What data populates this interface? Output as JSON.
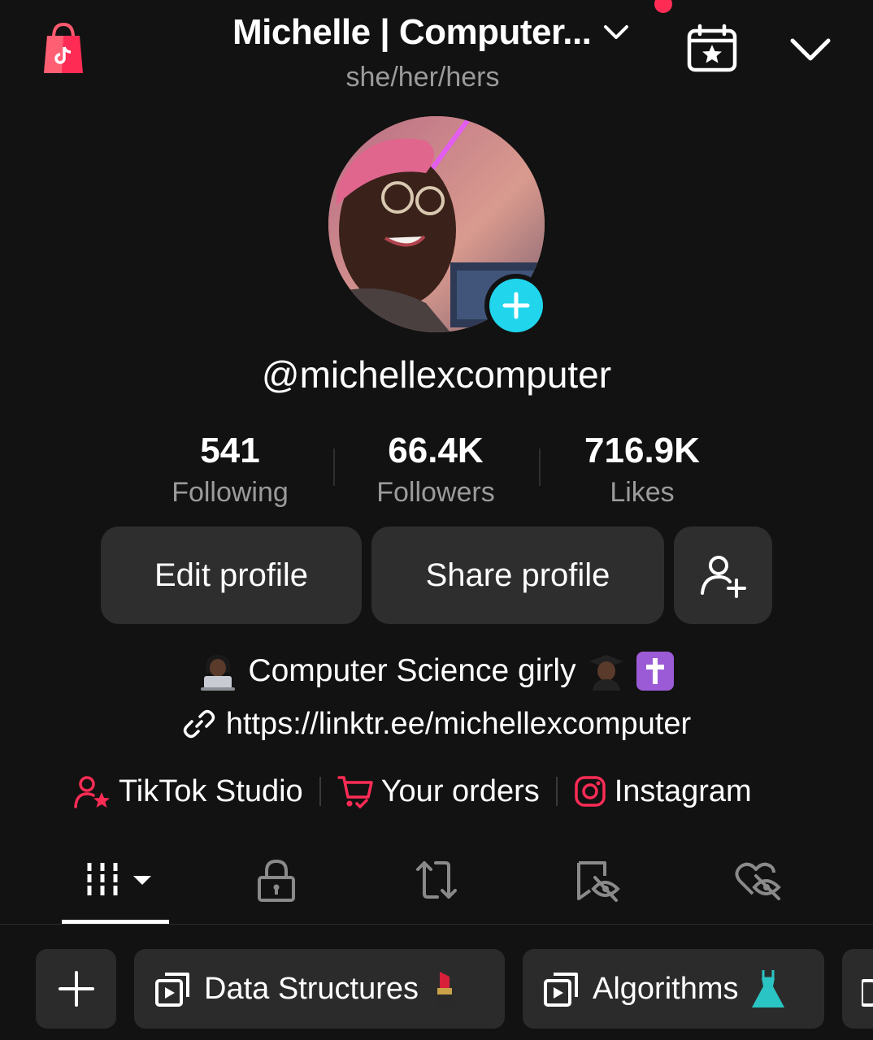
{
  "header": {
    "title": "Michelle | Computer...",
    "pronouns": "she/her/hers",
    "icons": [
      "tiktok-shop-icon",
      "chevron-down-icon",
      "calendar-star-icon",
      "chevron-down-icon"
    ],
    "notification_color": "#fe2c55"
  },
  "profile": {
    "username": "@michellexcomputer",
    "add_button_color": "#20d5ec"
  },
  "stats": [
    {
      "value": "541",
      "label": "Following"
    },
    {
      "value": "66.4K",
      "label": "Followers"
    },
    {
      "value": "716.9K",
      "label": "Likes"
    }
  ],
  "actions": {
    "edit": "Edit profile",
    "share": "Share profile",
    "add_friend_icon": "add-friend-icon"
  },
  "bio": {
    "text": "Computer Science girly",
    "emojis": [
      "technologist-emoji",
      "graduate-emoji",
      "latin-cross-emoji"
    ],
    "link": "https://linktr.ee/michellexcomputer"
  },
  "quick_links": [
    {
      "label": "TikTok Studio",
      "icon": "studio-icon"
    },
    {
      "label": "Your orders",
      "icon": "cart-icon"
    },
    {
      "label": "Instagram",
      "icon": "instagram-icon"
    }
  ],
  "tabs": [
    "videos-grid-icon",
    "private-lock-icon",
    "reposts-icon",
    "favorites-hidden-icon",
    "liked-hidden-icon"
  ],
  "playlists": [
    {
      "label": "Data Structures",
      "emoji": "lipstick-emoji"
    },
    {
      "label": "Algorithms",
      "emoji": "dress-emoji"
    }
  ],
  "colors": {
    "accent": "#fe2c55",
    "background": "#121212",
    "button": "#2e2e2e"
  }
}
